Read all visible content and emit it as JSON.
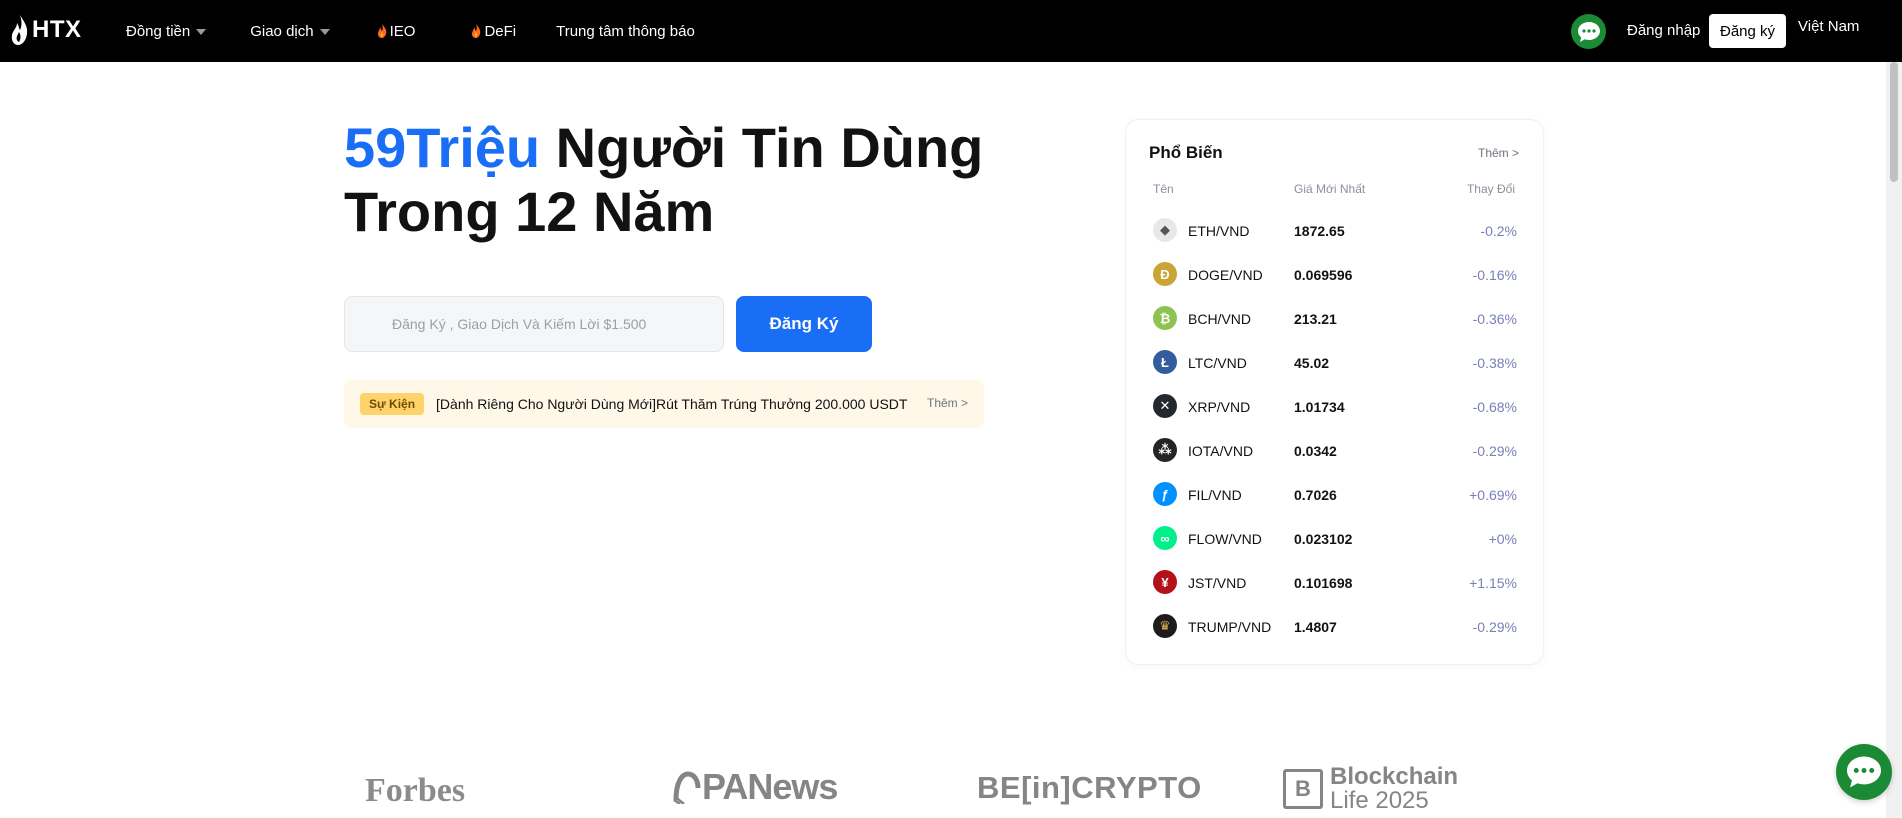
{
  "header": {
    "logo_text": "HTX",
    "nav": [
      {
        "label": "Đồng tiền",
        "caret": true,
        "fire": false
      },
      {
        "label": "Giao dịch",
        "caret": true,
        "fire": false
      },
      {
        "label": "IEO",
        "caret": false,
        "fire": true
      },
      {
        "label": "DeFi",
        "caret": false,
        "fire": true
      },
      {
        "label": "Trung tâm thông báo",
        "caret": false,
        "fire": false
      }
    ],
    "login_label": "Đăng nhập",
    "register_label": "Đăng ký",
    "language_label": "Việt Nam"
  },
  "hero": {
    "title_accent": "59Triệu",
    "title_rest": " Người Tin Dùng",
    "title_line2": "Trong 12 Năm",
    "input_placeholder": "Đăng Ký , Giao Dịch Và Kiếm Lời $1.500",
    "signup_label": "Đăng Ký",
    "event_badge": "Sự Kiện",
    "event_text": "[Dành Riêng Cho Người Dùng Mới]Rút Thăm Trúng Thưởng 200.000 USDT",
    "event_more": "Thêm >"
  },
  "popular": {
    "title": "Phổ Biến",
    "more": "Thêm >",
    "col_name": "Tên",
    "col_price": "Giá Mới Nhất",
    "col_change": "Thay Đổi",
    "rows": [
      {
        "icon": "eth-icon",
        "glyph": "◆",
        "color": "#e8e8e8",
        "glyph_color": "#555555",
        "pair": "ETH/VND",
        "price": "1872.65",
        "change": "-0.2%",
        "change_color": "#7a7fb8"
      },
      {
        "icon": "doge-icon",
        "glyph": "Ð",
        "color": "#c9a437",
        "glyph_color": "#ffffff",
        "pair": "DOGE/VND",
        "price": "0.069596",
        "change": "-0.16%",
        "change_color": "#7a7fb8"
      },
      {
        "icon": "bch-icon",
        "glyph": "₿",
        "color": "#8dc351",
        "glyph_color": "#ffffff",
        "pair": "BCH/VND",
        "price": "213.21",
        "change": "-0.36%",
        "change_color": "#7a7fb8"
      },
      {
        "icon": "ltc-icon",
        "glyph": "Ł",
        "color": "#345d9d",
        "glyph_color": "#ffffff",
        "pair": "LTC/VND",
        "price": "45.02",
        "change": "-0.38%",
        "change_color": "#7a7fb8"
      },
      {
        "icon": "xrp-icon",
        "glyph": "✕",
        "color": "#23292f",
        "glyph_color": "#ffffff",
        "pair": "XRP/VND",
        "price": "1.01734",
        "change": "-0.68%",
        "change_color": "#7a7fb8"
      },
      {
        "icon": "iota-icon",
        "glyph": "⁂",
        "color": "#242424",
        "glyph_color": "#ffffff",
        "pair": "IOTA/VND",
        "price": "0.0342",
        "change": "-0.29%",
        "change_color": "#7a7fb8"
      },
      {
        "icon": "fil-icon",
        "glyph": "ƒ",
        "color": "#0090ff",
        "glyph_color": "#ffffff",
        "pair": "FIL/VND",
        "price": "0.7026",
        "change": "+0.69%",
        "change_color": "#7a7fb8"
      },
      {
        "icon": "flow-icon",
        "glyph": "∞",
        "color": "#00ef8b",
        "glyph_color": "#ffffff",
        "pair": "FLOW/VND",
        "price": "0.023102",
        "change": "+0%",
        "change_color": "#7a7fb8"
      },
      {
        "icon": "jst-icon",
        "glyph": "¥",
        "color": "#b3121b",
        "glyph_color": "#ffffff",
        "pair": "JST/VND",
        "price": "0.101698",
        "change": "+1.15%",
        "change_color": "#7a7fb8"
      },
      {
        "icon": "trump-icon",
        "glyph": "♛",
        "color": "#1c1c1c",
        "glyph_color": "#d4b04c",
        "pair": "TRUMP/VND",
        "price": "1.4807",
        "change": "-0.29%",
        "change_color": "#7a7fb8"
      }
    ]
  },
  "press": {
    "forbes": "Forbes",
    "panews": "PANews",
    "beincrypto": "BE[in]CRYPTO",
    "blockchain_line1": "Blockchain",
    "blockchain_line2": "Life 2025"
  },
  "colors": {
    "accent": "#1a6ef5",
    "chat_green": "#1b8a35"
  }
}
